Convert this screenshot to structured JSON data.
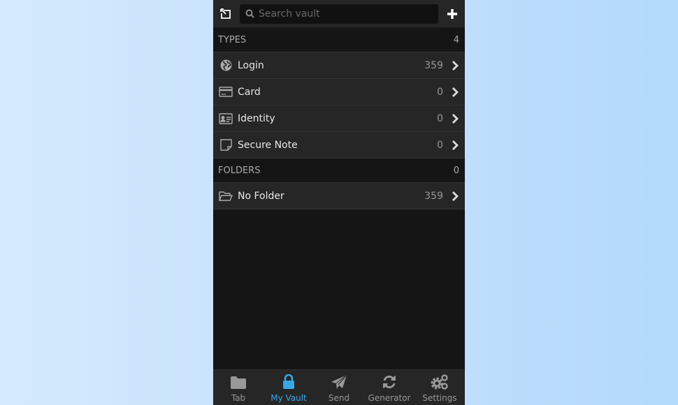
{
  "header": {
    "search_placeholder": "Search vault",
    "search_value": ""
  },
  "types": {
    "title": "TYPES",
    "count": "4",
    "items": [
      {
        "label": "Login",
        "count": "359",
        "icon": "globe-icon"
      },
      {
        "label": "Card",
        "count": "0",
        "icon": "credit-card-icon"
      },
      {
        "label": "Identity",
        "count": "0",
        "icon": "id-card-icon"
      },
      {
        "label": "Secure Note",
        "count": "0",
        "icon": "sticky-note-icon"
      }
    ]
  },
  "folders": {
    "title": "FOLDERS",
    "count": "0",
    "items": [
      {
        "label": "No Folder",
        "count": "359",
        "icon": "folder-open-icon"
      }
    ]
  },
  "tabs": [
    {
      "label": "Tab",
      "icon": "folder-icon"
    },
    {
      "label": "My Vault",
      "icon": "lock-icon",
      "active": true
    },
    {
      "label": "Send",
      "icon": "paper-plane-icon"
    },
    {
      "label": "Generator",
      "icon": "refresh-icon"
    },
    {
      "label": "Settings",
      "icon": "gears-icon"
    }
  ],
  "colors": {
    "accent": "#3aa6ea",
    "panel": "#262626",
    "background": "#151515"
  }
}
